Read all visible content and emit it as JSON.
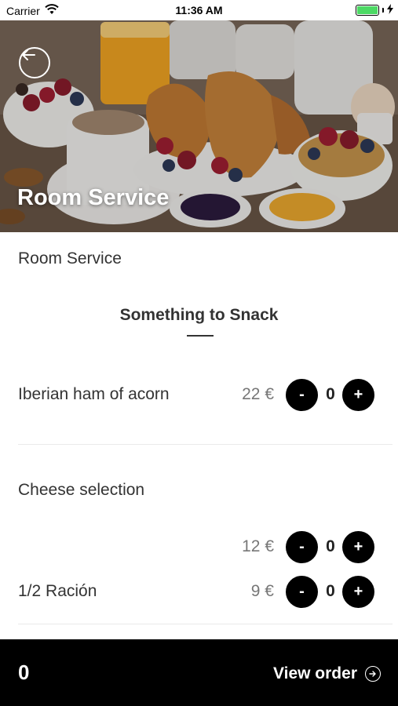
{
  "status_bar": {
    "carrier": "Carrier",
    "time": "11:36 AM",
    "battery_color": "#4cd964",
    "wifi_icon": "wifi-icon",
    "charging_icon": "bolt-icon"
  },
  "header": {
    "title": "Room Service",
    "back_icon": "arrow-left-circle-icon"
  },
  "breadcrumb": "Room Service",
  "section": {
    "title": "Something to Snack"
  },
  "items": [
    {
      "name": "Iberian ham of acorn",
      "price": "22 €",
      "minus": "-",
      "qty": "0",
      "plus": "+"
    },
    {
      "name": "Cheese selection",
      "options": [
        {
          "label": "",
          "price": "12 €",
          "minus": "-",
          "qty": "0",
          "plus": "+"
        },
        {
          "label": "1/2 Ración",
          "price": "9 €",
          "minus": "-",
          "qty": "0",
          "plus": "+"
        }
      ]
    }
  ],
  "footer": {
    "count": "0",
    "view_order_label": "View order",
    "arrow_icon": "arrow-right-circle-icon"
  }
}
